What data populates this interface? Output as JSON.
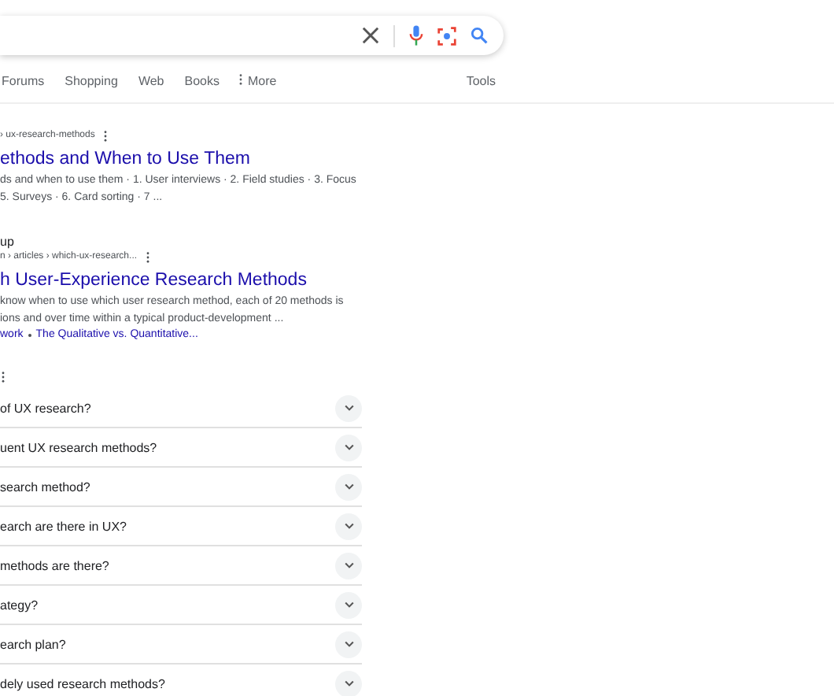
{
  "tabs": [
    {
      "label": "Forums",
      "selected": false
    },
    {
      "label": "Shopping",
      "selected": false
    },
    {
      "label": "Web",
      "selected": false
    },
    {
      "label": "Books",
      "selected": false
    },
    {
      "label": "More",
      "selected": false,
      "kind": "more"
    }
  ],
  "tools": "Tools",
  "results": [
    {
      "url": "› ux-research-methods",
      "title": "ethods and When to Use Them",
      "snippet": [
        "ds and when to use them · 1. User interviews · 2. Field studies · 3. Focus",
        "5. Surveys · 6. Card sorting · 7 ..."
      ]
    },
    {
      "site": "up",
      "url": "n › articles › which-ux-research...",
      "title": "h User-Experience Research Methods",
      "snippet": [
        "know when to use which user research method, each of 20 methods is",
        "ions and over time within a typical product-development ..."
      ],
      "links": [
        "work",
        "The Qualitative vs. Quantitative..."
      ]
    }
  ],
  "questions": [
    {
      "text": "of UX research?",
      "expanded": false
    },
    {
      "text": "uent UX research methods?",
      "expanded": false
    },
    {
      "text": "search method?",
      "expanded": false
    },
    {
      "text": "earch are there in UX?",
      "expanded": false
    },
    {
      "text": "methods are there?",
      "expanded": false
    },
    {
      "text": "ategy?",
      "expanded": false
    },
    {
      "text": "earch plan?",
      "expanded": false
    },
    {
      "text": "dely used research methods?",
      "expanded": false
    }
  ]
}
